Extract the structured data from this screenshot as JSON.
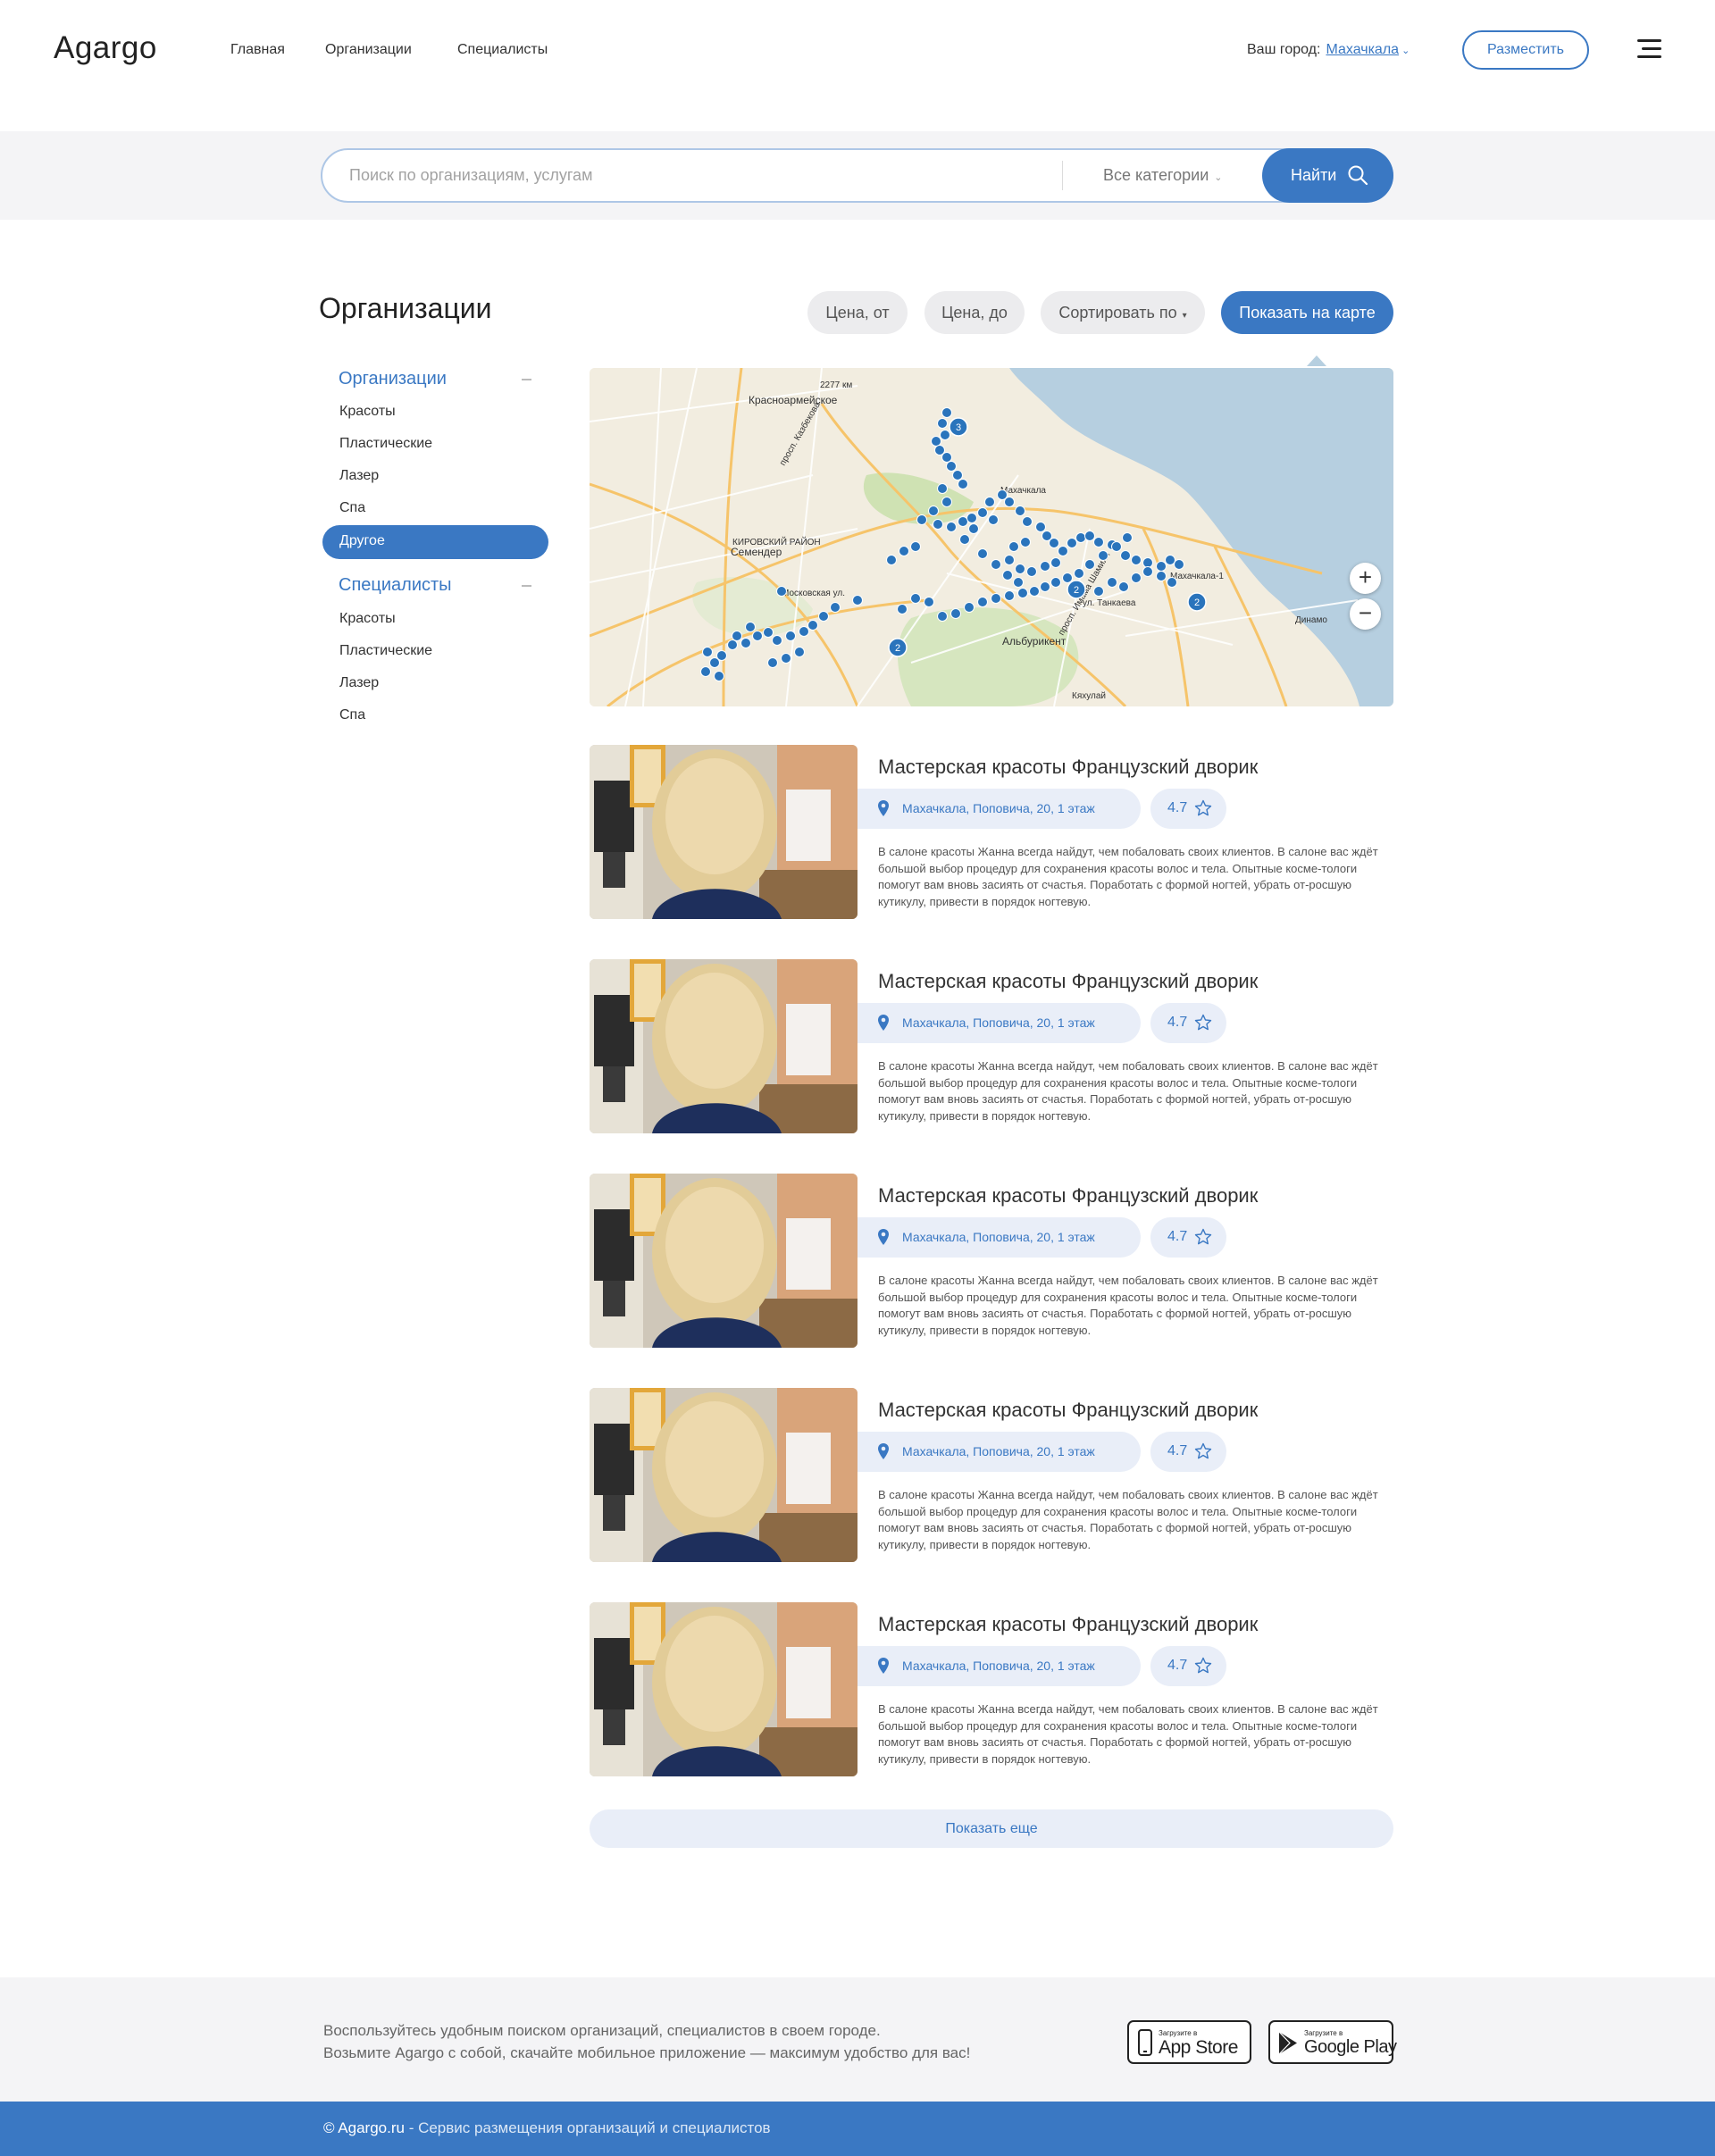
{
  "header": {
    "logo": "Agargo",
    "nav": [
      "Главная",
      "Организации",
      "Специалисты"
    ],
    "city_label": "Ваш город:",
    "city": "Махачкала",
    "post_button": "Разместить"
  },
  "search": {
    "placeholder": "Поиск по организациям, услугам",
    "category": "Все категории",
    "button": "Найти"
  },
  "main": {
    "title": "Организации",
    "filters": {
      "price_from": "Цена, от",
      "price_to": "Цена, до",
      "sort": "Сортировать по",
      "show_map": "Показать на карте"
    }
  },
  "sidebar": {
    "groups": [
      {
        "title": "Организации",
        "items": [
          "Красоты",
          "Пластические",
          "Лазер",
          "Спа",
          "Другое"
        ],
        "active": "Другое"
      },
      {
        "title": "Специалисты",
        "items": [
          "Красоты",
          "Пластические",
          "Лазер",
          "Спа"
        ]
      }
    ]
  },
  "map": {
    "labels": [
      "Красноармейское",
      "2277 км",
      "просп. Казбекова",
      "Махачкала",
      "Семендер",
      "КИРОВСКИЙ РАЙОН",
      "Московская ул.",
      "Альбурикент",
      "ул. Танкаева",
      "просп. Имама Шамиля",
      "Кяхулай",
      "Динамо",
      "Махачкала-1"
    ],
    "zoom_in": "+",
    "zoom_out": "−",
    "cluster_counts": [
      "3",
      "2",
      "2",
      "2"
    ]
  },
  "cards": [
    {
      "title": "Мастерская красоты Французский дворик",
      "address": "Махачкала, Поповича, 20, 1 этаж",
      "rating": "4.7",
      "description": "В салоне красоты Жанна всегда найдут, чем побаловать своих клиентов. В салоне вас ждёт большой выбор процедур для сохранения красоты волос и тела. Опытные косме-тологи помогут вам вновь засиять от счастья. Поработать с формой ногтей, убрать от-росшую кутикулу, привести в порядок ногтевую."
    },
    {
      "title": "Мастерская красоты Французский дворик",
      "address": "Махачкала, Поповича, 20, 1 этаж",
      "rating": "4.7",
      "description": "В салоне красоты Жанна всегда найдут, чем побаловать своих клиентов. В салоне вас ждёт большой выбор процедур для сохранения красоты волос и тела. Опытные косме-тологи помогут вам вновь засиять от счастья. Поработать с формой ногтей, убрать от-росшую кутикулу, привести в порядок ногтевую."
    },
    {
      "title": "Мастерская красоты Французский дворик",
      "address": "Махачкала, Поповича, 20, 1 этаж",
      "rating": "4.7",
      "description": "В салоне красоты Жанна всегда найдут, чем побаловать своих клиентов. В салоне вас ждёт большой выбор процедур для сохранения красоты волос и тела. Опытные косме-тологи помогут вам вновь засиять от счастья. Поработать с формой ногтей, убрать от-росшую кутикулу, привести в порядок ногтевую."
    },
    {
      "title": "Мастерская красоты Французский дворик",
      "address": "Махачкала, Поповича, 20, 1 этаж",
      "rating": "4.7",
      "description": "В салоне красоты Жанна всегда найдут, чем побаловать своих клиентов. В салоне вас ждёт большой выбор процедур для сохранения красоты волос и тела. Опытные косме-тологи помогут вам вновь засиять от счастья. Поработать с формой ногтей, убрать от-росшую кутикулу, привести в порядок ногтевую."
    },
    {
      "title": "Мастерская красоты Французский дворик",
      "address": "Махачкала, Поповича, 20, 1 этаж",
      "rating": "4.7",
      "description": "В салоне красоты Жанна всегда найдут, чем побаловать своих клиентов. В салоне вас ждёт большой выбор процедур для сохранения красоты волос и тела. Опытные косме-тологи помогут вам вновь засиять от счастья. Поработать с формой ногтей, убрать от-росшую кутикулу, привести в порядок ногтевую."
    }
  ],
  "show_more": "Показать еще",
  "footer": {
    "line1": "Воспользуйтесь удобным поиском организаций, специалистов в своем городе.",
    "line2": "Возьмите Agargo с собой, скачайте мобильное приложение — максимум удобство для вас!",
    "appstore_small": "Загрузите в",
    "appstore_big": "App Store",
    "googleplay_small": "Загрузите в",
    "googleplay_big": "Google Play",
    "copyright_brand": "© Agargo.ru",
    "copyright_rest": " - Сервис размещения организаций и специалистов"
  },
  "colors": {
    "accent": "#3a78c3",
    "pill_bg": "#e9eef8",
    "band_bg": "#f4f4f6",
    "map_water": "#b6cfe0",
    "marker": "#2a74bc"
  },
  "icons": [
    "search-icon",
    "pin-icon",
    "star-icon",
    "menu-icon",
    "apple-icon",
    "google-play-icon",
    "chevron-down-icon",
    "minus-icon"
  ]
}
